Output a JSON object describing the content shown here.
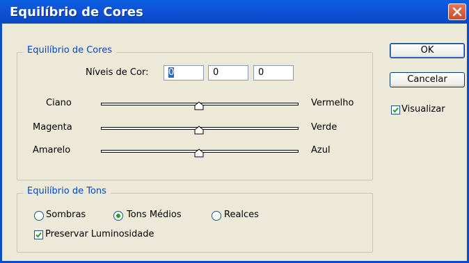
{
  "window": {
    "title": "Equilíbrio de Cores"
  },
  "color_group": {
    "legend": "Equilíbrio de Cores",
    "levels_label": "Níveis de Cor:",
    "levels": [
      "0",
      "0",
      "0"
    ],
    "sliders": [
      {
        "left": "Ciano",
        "right": "Vermelho",
        "value": 0
      },
      {
        "left": "Magenta",
        "right": "Verde",
        "value": 0
      },
      {
        "left": "Amarelo",
        "right": "Azul",
        "value": 0
      }
    ]
  },
  "tone_group": {
    "legend": "Equilíbrio de Tons",
    "options": [
      "Sombras",
      "Tons Médios",
      "Realces"
    ],
    "selected": "Tons Médios",
    "preserve_label": "Preservar Luminosidade",
    "preserve_checked": true
  },
  "buttons": {
    "ok": "OK",
    "cancel": "Cancelar"
  },
  "preview": {
    "label": "Visualizar",
    "checked": true
  },
  "colors": {
    "titlebar": "#0A5FE0",
    "legend": "#0046D5",
    "radio_dot": "#21A121",
    "check": "#21A121"
  }
}
